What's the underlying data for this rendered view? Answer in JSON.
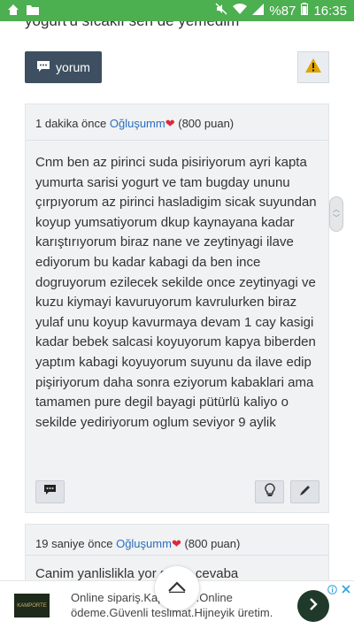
{
  "statusbar": {
    "battery": "%87",
    "time": "16:35",
    "icons": [
      "home-icon",
      "folder-icon",
      "mute-icon",
      "wifi-icon",
      "signal-icon",
      "battery-icon"
    ]
  },
  "page": {
    "cut_text": "yogurt'u sıcaklı sen de yemedim"
  },
  "actions": {
    "yorum_label": "yorum",
    "accent": "#3d4f61",
    "warn_color": "#e0a400"
  },
  "comments": [
    {
      "time": "1 dakika önce",
      "user": "Oğluşumm",
      "points": "(800 puan)",
      "text": "Cnm ben az pirinci suda pisiriyorum ayri kapta yumurta sarisi yogurt ve tam bugday ununu çırpıyorum  az pirinci  hasladigim sicak suyundan koyup yumsatiyorum dkup kaynayana kadar karıştırıyorum  biraz nane ve zeytinyagi  ilave ediyorum bu kadar kabagi da ben ince dogruyorum ezilecek sekilde once zeytinyagi ve kuzu kiymayi kavuruyorum kavrulurken biraz yulaf unu koyup kavurmaya devam 1 cay kasigi kadar bebek salcasi koyuyorum kapya biberden  yaptım  kabagi koyuyorum suyunu da ilave edip pişiriyorum  daha sonra eziyorum  kabaklari ama tamamen pure degil bayagi pütürlü kaliyo o sekilde yediriyorum oglum seviyor 9 aylik"
    },
    {
      "time": "19 saniye önce",
      "user": "Oğluşumm",
      "points": "(800 puan)",
      "text": "Canim yanlislikla yor    senin cevaba"
    }
  ],
  "ad": {
    "text": "Online sipariş.Kap    deme.Online ödeme.Güvenli teslimat.Hijneyik üretim.",
    "logo_text": "KAMPORTE"
  }
}
